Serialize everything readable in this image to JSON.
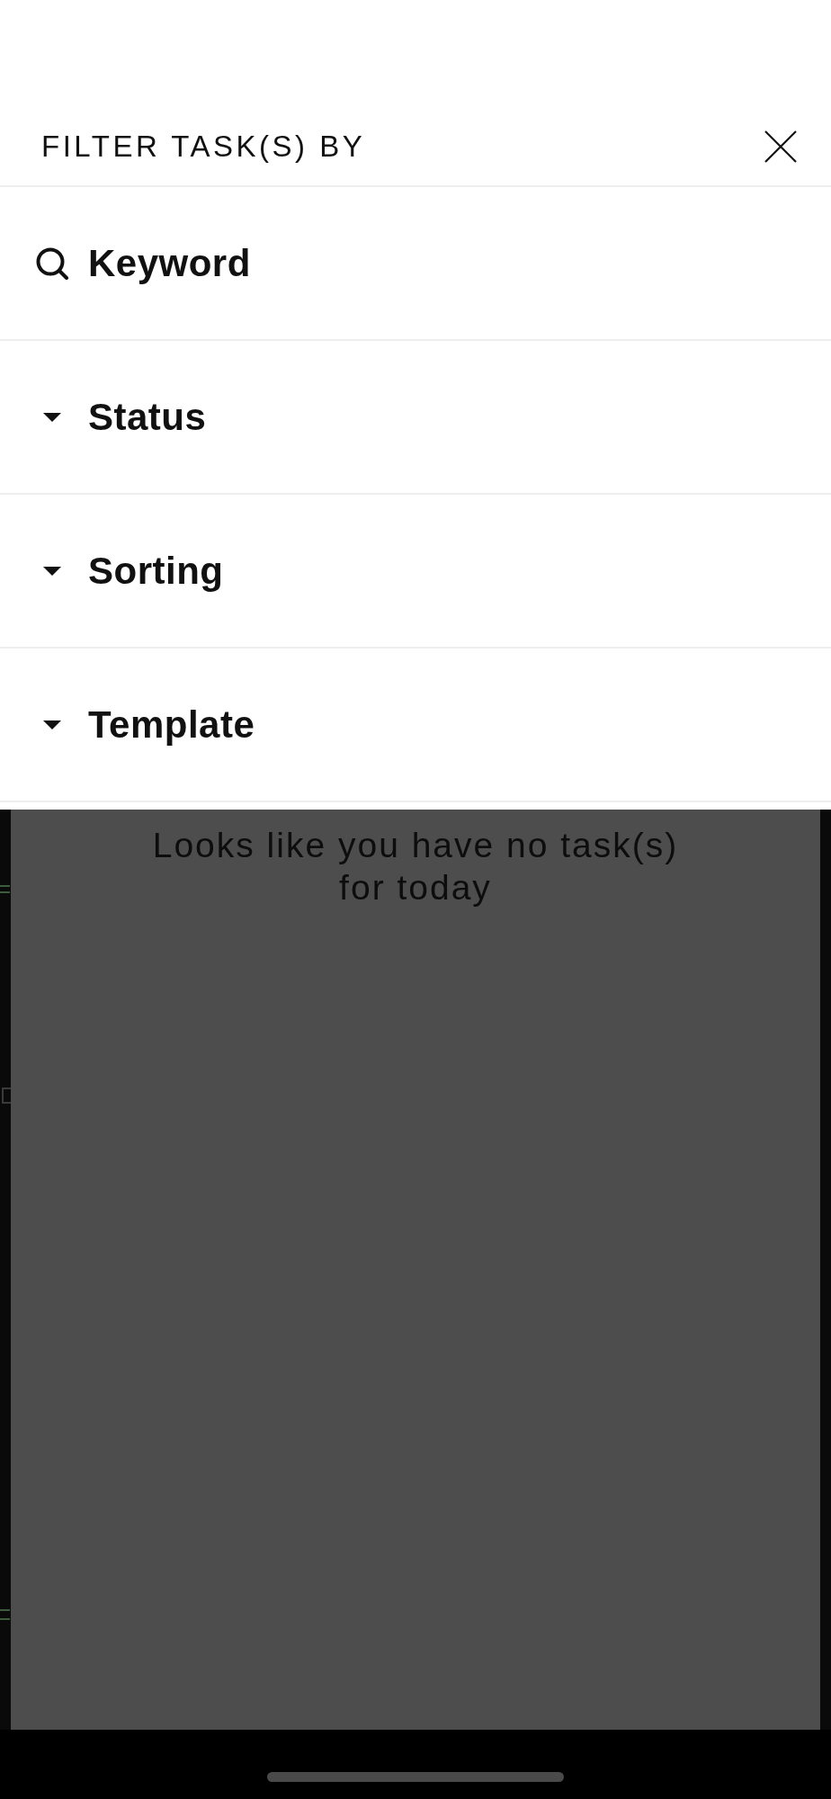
{
  "header": {
    "title": "FILTER TASK(S) BY"
  },
  "filters": [
    {
      "kind": "search",
      "label": "Keyword"
    },
    {
      "kind": "dropdown",
      "label": "Status"
    },
    {
      "kind": "dropdown",
      "label": "Sorting"
    },
    {
      "kind": "dropdown",
      "label": "Template"
    }
  ],
  "empty_state": {
    "message": "Looks like you have no task(s) for today"
  }
}
